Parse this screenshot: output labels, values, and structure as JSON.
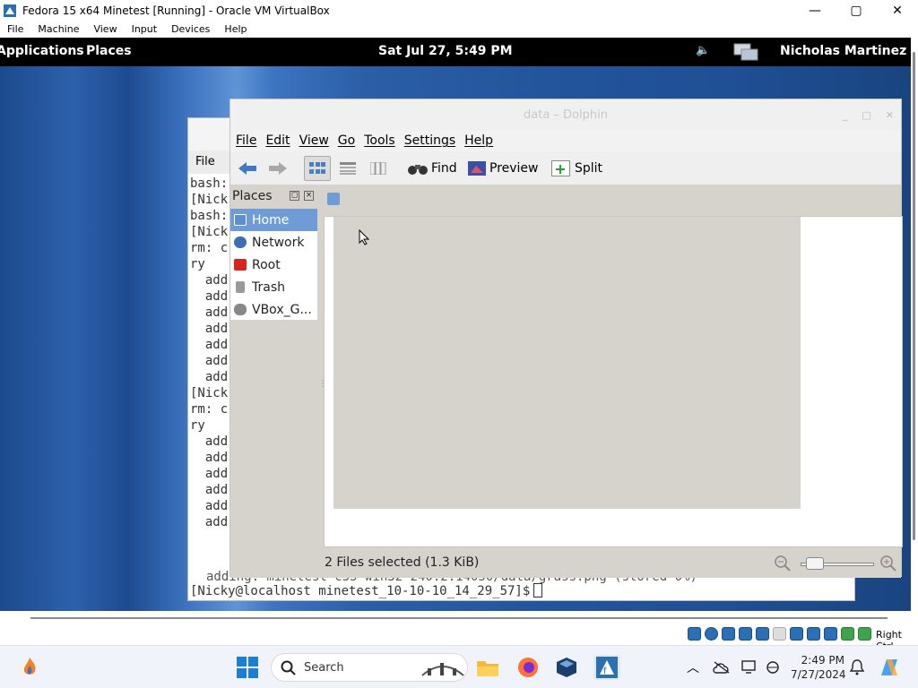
{
  "window": {
    "title": "Fedora 15 x64 Minetest [Running] - Oracle VM VirtualBox",
    "menu": [
      "File",
      "Machine",
      "View",
      "Input",
      "Devices",
      "Help"
    ]
  },
  "gnome_panel": {
    "applications": "Applications",
    "places": "Places",
    "clock": "Sat Jul 27,  5:49 PM",
    "user": "Nicholas Martinez"
  },
  "terminal": {
    "menu_label": "File",
    "lines": [
      "bash:",
      "[Nick",
      "bash:",
      "[Nick",
      "rm: c",
      "ry",
      "  add",
      "  add",
      "  add",
      "  add",
      "  add",
      "  add",
      "  add",
      "[Nick",
      "rm: c",
      "ry",
      "  add",
      "  add",
      "  add",
      "  add",
      "  add",
      "  add"
    ],
    "overlap_line": "adding: minetest-c55-win32-240.2.14050/data/grass.png (stored 0%)",
    "prompt": "[Nicky@localhost minetest_10-10-10_14_29_57]$"
  },
  "dolphin": {
    "title": "data – Dolphin",
    "menu": [
      "File",
      "Edit",
      "View",
      "Go",
      "Tools",
      "Settings",
      "Help"
    ],
    "toolbar": {
      "find": "Find",
      "preview": "Preview",
      "split": "Split"
    },
    "places_header": "Places",
    "places": [
      {
        "label": "Home",
        "icon": "home-icon",
        "color": "#5a8fd0",
        "selected": true
      },
      {
        "label": "Network",
        "icon": "network-icon",
        "color": "#3a6fb5",
        "selected": false
      },
      {
        "label": "Root",
        "icon": "root-folder-icon",
        "color": "#d9231f",
        "selected": false
      },
      {
        "label": "Trash",
        "icon": "trash-icon",
        "color": "#9a9a9a",
        "selected": false
      },
      {
        "label": "VBox_G...",
        "icon": "drive-icon",
        "color": "#888888",
        "selected": false
      }
    ],
    "status": "2 Files selected (1.3 KiB)"
  },
  "vbox_status": {
    "host_key": "Right Ctrl"
  },
  "taskbar": {
    "search_placeholder": "Search",
    "time": "2:49 PM",
    "date": "7/27/2024"
  }
}
